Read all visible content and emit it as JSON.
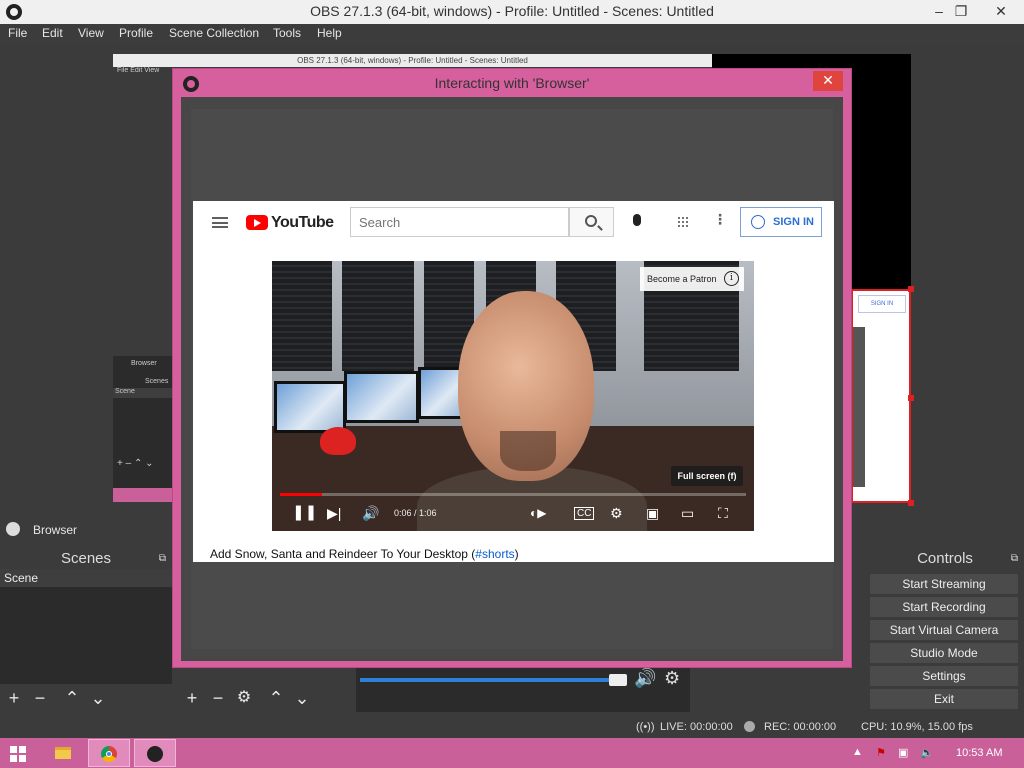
{
  "window": {
    "title": "OBS 27.1.3 (64-bit, windows) - Profile: Untitled - Scenes: Untitled",
    "minimize": "–",
    "restore": "❐",
    "close": "✕"
  },
  "menu": [
    "File",
    "Edit",
    "View",
    "Profile",
    "Scene Collection",
    "Tools",
    "Help"
  ],
  "nested_preview": {
    "title": "OBS 27.1.3 (64-bit, windows) - Profile: Untitled - Scenes: Untitled",
    "menu": "File  Edit  View",
    "source": "Browser",
    "scenes": "Scenes",
    "scene": "Scene",
    "signin": "SIGN IN"
  },
  "source_bar": {
    "label": "Browser"
  },
  "scenes_dock": {
    "title": "Scenes",
    "items": [
      "Scene"
    ]
  },
  "controls_dock": {
    "title": "Controls",
    "buttons": [
      "Start Streaming",
      "Start Recording",
      "Start Virtual Camera",
      "Studio Mode",
      "Settings",
      "Exit"
    ]
  },
  "status": {
    "live": "LIVE: 00:00:00",
    "rec": "REC: 00:00:00",
    "cpu": "CPU: 10.9%, 15.00 fps"
  },
  "taskbar": {
    "time": "10:53 AM",
    "apps": [
      "file-explorer-icon",
      "chrome-icon",
      "obs-icon"
    ]
  },
  "dialog": {
    "title": "Interacting with 'Browser'",
    "close": "✕"
  },
  "youtube": {
    "logo_text": "YouTube",
    "search_placeholder": "Search",
    "signin": "SIGN IN",
    "patron": "Become a Patron",
    "info": "i",
    "fullscreen_tip": "Full screen (f)",
    "time": "0:06 / 1:06",
    "progress": 0.09,
    "video_title": "Add Snow, Santa and Reindeer To Your Desktop (",
    "video_tag": "#shorts",
    "video_title_end": ")"
  }
}
